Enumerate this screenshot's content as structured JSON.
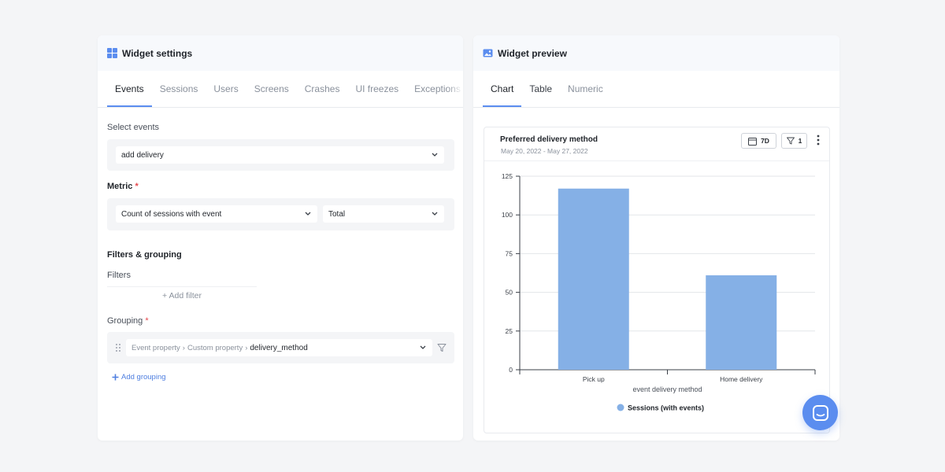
{
  "settings": {
    "title": "Widget settings",
    "icon": "grid-icon",
    "tabs": [
      "Events",
      "Sessions",
      "Users",
      "Screens",
      "Crashes",
      "UI freezes",
      "Exceptions"
    ],
    "active_tab": "Events",
    "select_events": {
      "label": "Select events",
      "value": "add delivery"
    },
    "metric": {
      "label": "Metric",
      "required": "*",
      "value": "Count of sessions with event",
      "aggregation": "Total"
    },
    "filters_grouping": {
      "heading": "Filters & grouping",
      "filters_label": "Filters",
      "add_filter": "+ Add filter",
      "grouping_label": "Grouping",
      "grouping_required": "*",
      "grouping_path": [
        "Event property",
        "Custom property",
        "delivery_method"
      ],
      "add_grouping": "Add grouping"
    }
  },
  "preview": {
    "title": "Widget preview",
    "icon": "image-icon",
    "tabs": [
      "Chart",
      "Table",
      "Numeric"
    ],
    "active_tab": "Chart",
    "card": {
      "title": "Preferred delivery method",
      "date_range": "May 20, 2022 - May 27, 2022",
      "period_button": "7D",
      "filter_count": "1"
    }
  },
  "chart_data": {
    "type": "bar",
    "title": "Preferred delivery method",
    "categories": [
      "Pick up",
      "Home delivery"
    ],
    "series": [
      {
        "name": "Sessions (with events)",
        "values": [
          117,
          61
        ]
      }
    ],
    "xlabel": "event delivery method",
    "ylabel": "",
    "ylim": [
      0,
      125
    ],
    "yticks": [
      0,
      25,
      50,
      75,
      100,
      125
    ],
    "grid": true,
    "legend": "bottom",
    "color": "#85b0e6"
  },
  "colors": {
    "accent": "#5b8def",
    "bar": "#85b0e6",
    "required": "#e5484d"
  },
  "chat_button": {
    "icon": "chat-icon"
  }
}
